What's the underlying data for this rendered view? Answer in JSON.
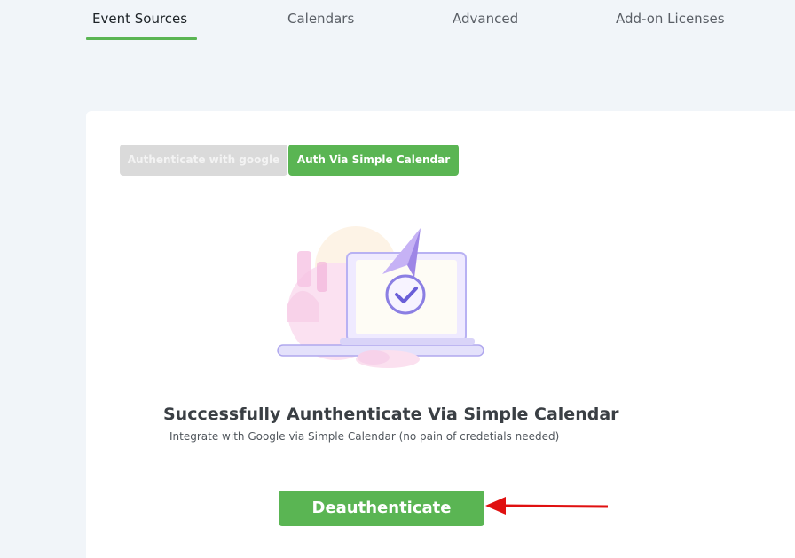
{
  "nav": {
    "tabs": [
      {
        "label": "Event Sources",
        "active": true
      },
      {
        "label": "Calendars",
        "active": false
      },
      {
        "label": "Advanced",
        "active": false
      },
      {
        "label": "Add-on Licenses",
        "active": false
      }
    ]
  },
  "auth": {
    "google_label": "Authenticate with google",
    "simple_label": "Auth Via Simple Calendar"
  },
  "status": {
    "headline": "Successfully Aunthenticate Via Simple Calendar",
    "subtext": "Integrate with Google via Simple Calendar (no pain of credetials needed)"
  },
  "actions": {
    "deauth_label": "Deauthenticate"
  },
  "colors": {
    "accent": "#5ab553",
    "annotation_arrow": "#e01010"
  }
}
